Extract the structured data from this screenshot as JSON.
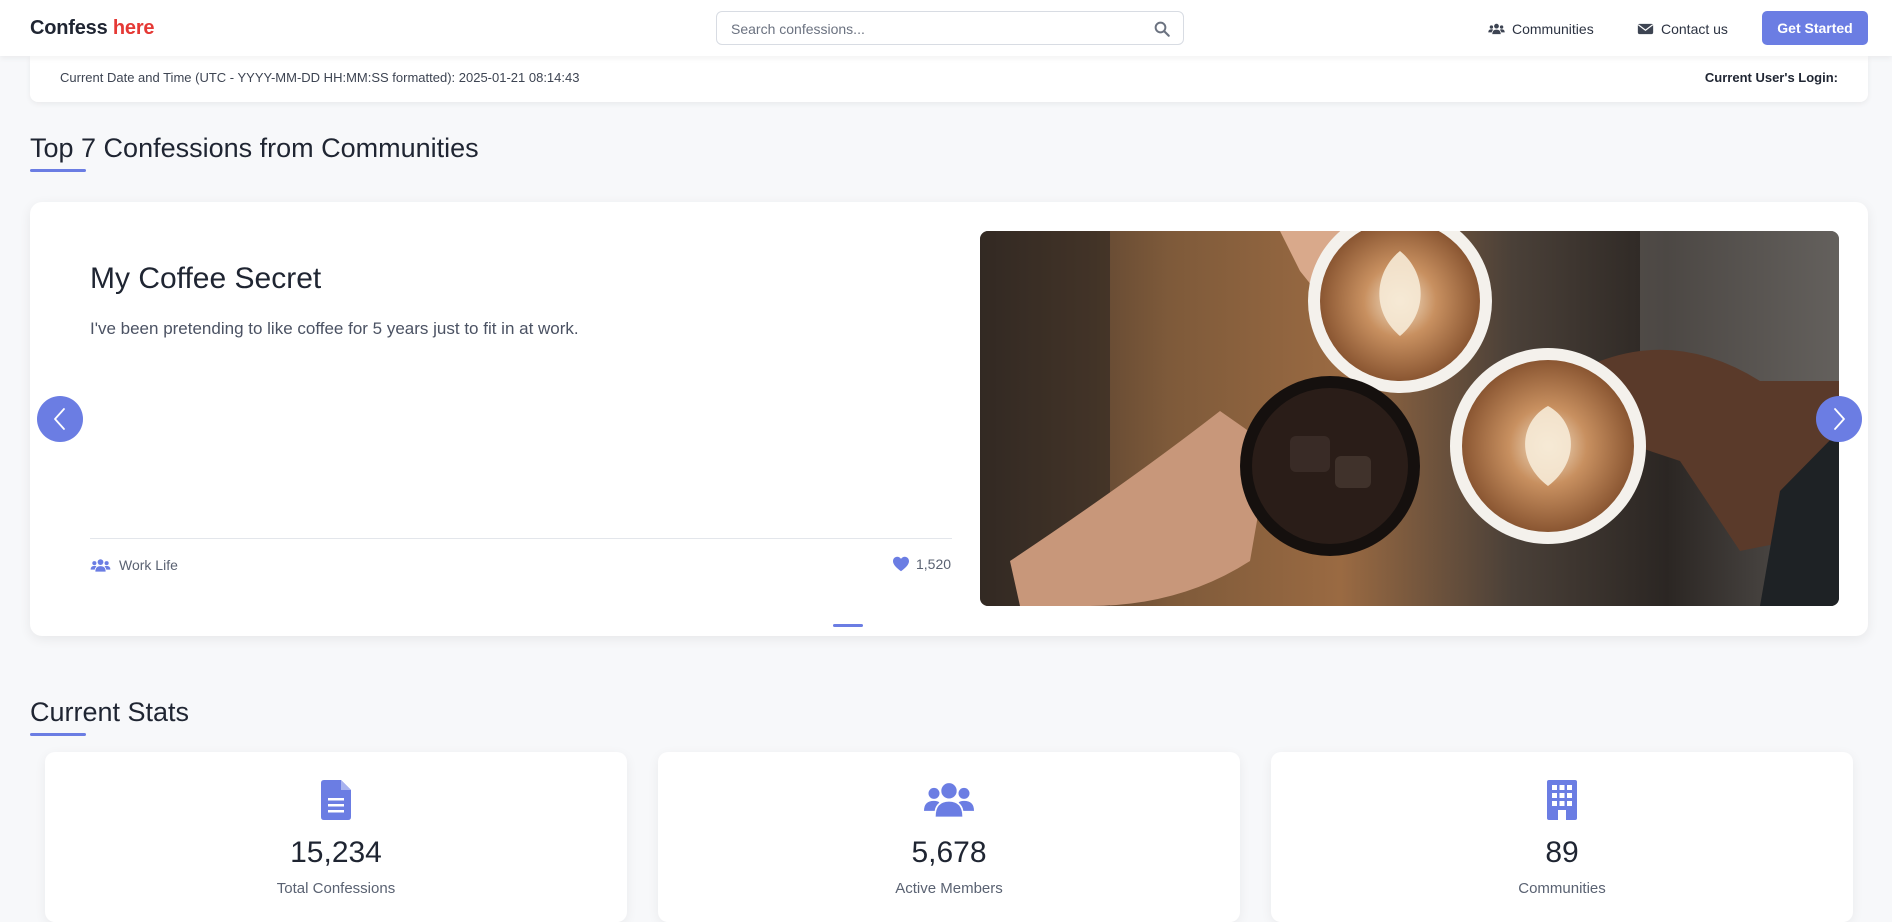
{
  "header": {
    "brand_main": "Confess",
    "brand_accent": "here",
    "search_placeholder": "Search confessions...",
    "nav": [
      {
        "label": "Communities",
        "icon": "users-icon"
      },
      {
        "label": "Contact us",
        "icon": "envelope-icon"
      }
    ],
    "cta_label": "Get Started"
  },
  "infobar": {
    "datetime_text": "Current Date and Time (UTC - YYYY-MM-DD HH:MM:SS formatted): 2025-01-21 08:14:43",
    "login_text": "Current User's Login:"
  },
  "top_section": {
    "title": "Top 7 Confessions from Communities",
    "slide": {
      "title": "My Coffee Secret",
      "text": "I've been pretending to like coffee for 5 years just to fit in at work.",
      "community": "Work Life",
      "likes": "1,520",
      "image": "coffee-cups-photo"
    }
  },
  "stats_section": {
    "title": "Current Stats",
    "cards": [
      {
        "value": "15,234",
        "label": "Total Confessions",
        "icon": "document-icon"
      },
      {
        "value": "5,678",
        "label": "Active Members",
        "icon": "users-icon"
      },
      {
        "value": "89",
        "label": "Communities",
        "icon": "building-icon"
      }
    ]
  },
  "colors": {
    "accent": "#6b7de3",
    "brand_accent": "#e53935",
    "background": "#f7f8fa"
  }
}
